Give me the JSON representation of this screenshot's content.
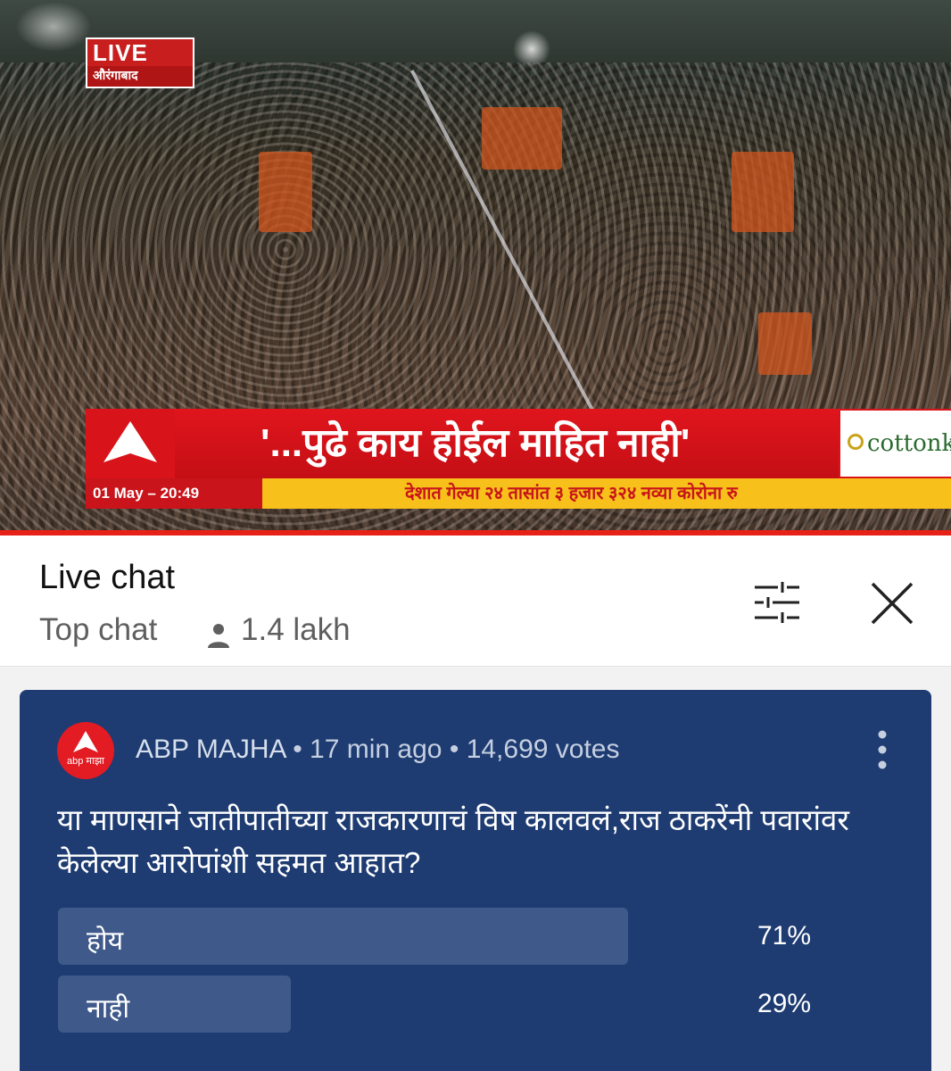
{
  "video": {
    "live_badge": "LIVE",
    "location": "औरंगाबाद",
    "headline": "'...पुढे काय होईल माहित नाही'",
    "sponsor": "cottonking",
    "timestamp": "01 May – 20:49",
    "ticker": "देशात गेल्या २४ तासांत ३ हजार ३२४ नव्या कोरोना रु"
  },
  "chat_header": {
    "title": "Live chat",
    "mode": "Top chat",
    "viewers": "1.4 lakh"
  },
  "poll": {
    "avatar_text": "abp माझा",
    "author": "ABP MAJHA",
    "separator": "•",
    "time": "17 min ago",
    "votes": "14,699 votes",
    "question": "या माणसाने जातीपातीच्या राजकारणाचं विष कालवलं,राज ठाकरेंनी पवारांवर केलेल्या आरोपांशी सहमत आहात?",
    "options": [
      {
        "label": "होय",
        "percent_text": "71%",
        "percent": 71
      },
      {
        "label": "नाही",
        "percent_text": "29%",
        "percent": 29
      }
    ],
    "colors": {
      "card": "#1e3c72",
      "bar": "#3f5a8a",
      "accent": "#e31b23"
    }
  }
}
